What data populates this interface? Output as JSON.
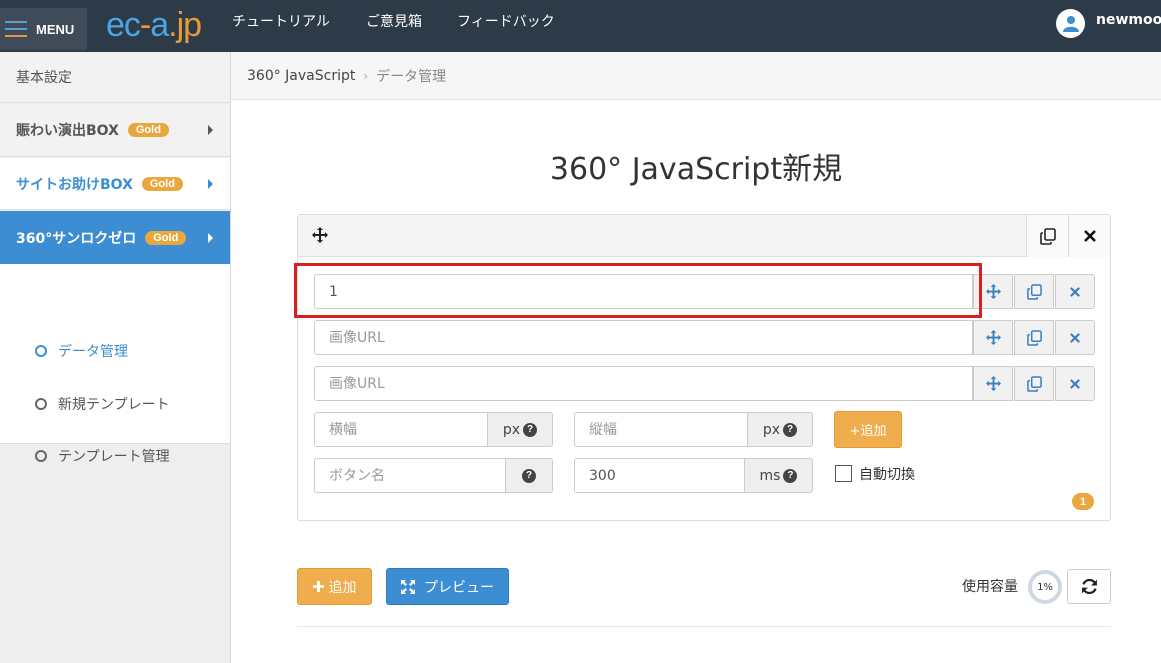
{
  "topbar": {
    "menu_label": "MENU",
    "logo": {
      "part1": "ec",
      "part2": "-",
      "part3": "a",
      "part4": ".jp"
    },
    "nav": [
      "チュートリアル",
      "ご意見箱",
      "フィードバック"
    ],
    "user_name": "newmoon"
  },
  "sidebar": {
    "basic": "基本設定",
    "items": [
      {
        "label": "賑わい演出BOX",
        "badge": "Gold"
      },
      {
        "label": "サイトお助けBOX",
        "badge": "Gold"
      },
      {
        "label": "360°サンロクゼロ",
        "badge": "Gold"
      }
    ],
    "sub_items": [
      "データ管理",
      "新規テンプレート",
      "テンプレート管理"
    ]
  },
  "breadcrumb": {
    "parent": "360° JavaScript",
    "sep": "›",
    "current": "データ管理"
  },
  "page_title": "360° JavaScript新規",
  "form": {
    "field1_value": "1",
    "url_placeholder": "画像URL",
    "width_placeholder": "横幅",
    "height_placeholder": "縦幅",
    "px_unit": "px",
    "add_small_label": "+追加",
    "button_name_placeholder": "ボタン名",
    "interval_value": "300",
    "ms_unit": "ms",
    "auto_switch_label": "自動切換",
    "count_badge": "1"
  },
  "footer": {
    "add_label": "追加",
    "preview_label": "プレビュー",
    "usage_label": "使用容量",
    "usage_value": "1%"
  },
  "colors": {
    "accent_blue": "#3c8dd1",
    "accent_orange": "#f0ad4e",
    "highlight_red": "#d9201f",
    "topbar": "#2d3a48"
  }
}
